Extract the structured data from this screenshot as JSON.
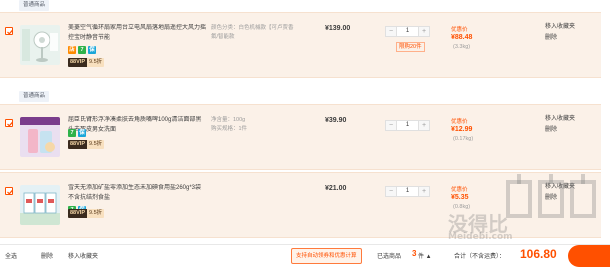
{
  "groups": [
    {
      "label": "普通商品"
    },
    {
      "label": "普通商品"
    }
  ],
  "items": [
    {
      "title": "美菱空气循环扇家用台立电风扇落地扇遥控大风力摇控宝时静音节能",
      "badges": [
        "店",
        "7",
        "保"
      ],
      "vip_left": "88VIP",
      "vip_right": "9.5折",
      "sku_line1": "颜色分类：白色机械款【可卢贾香",
      "sku_line2": "氟/智能款",
      "price": "¥139.00",
      "qty": "1",
      "qty_minus": "−",
      "qty_plus": "+",
      "limit": "限购20件",
      "sub_label": "优惠价",
      "sub_total": "¥88.48",
      "weight": "(3.3kg)",
      "op1": "移入收藏夹",
      "op2": "删除"
    },
    {
      "title": "屈臣氏臂形浮净凑柔肤去角质嘴啤100g清洁面部黑头去死皮男女洗面",
      "badges": [
        "7",
        "保"
      ],
      "vip_left": "88VIP",
      "vip_right": "9.5折",
      "sku_line1": "净含量：100g",
      "sku_line2": "购买规格：1件",
      "price": "¥39.90",
      "qty": "1",
      "qty_minus": "−",
      "qty_plus": "+",
      "limit": "",
      "sub_label": "优惠价",
      "sub_total": "¥12.99",
      "weight": "(0.17kg)",
      "op1": "移入收藏夹",
      "op2": "删除"
    },
    {
      "title": "雪天无添加矿盐零添加生态未加碘食用盐260g*3袋不含抗结剂食盐",
      "badges": [
        "7",
        "保"
      ],
      "vip_left": "88VIP",
      "vip_right": "9.5折",
      "sku_line1": "",
      "sku_line2": "",
      "price": "¥21.00",
      "qty": "1",
      "qty_minus": "−",
      "qty_plus": "+",
      "limit": "",
      "sub_label": "优惠价",
      "sub_total": "¥5.35",
      "weight": "(0.8kg)",
      "op1": "移入收藏夹",
      "op2": "删除"
    }
  ],
  "footer": {
    "select_all": "全选",
    "delete": "删除",
    "move_fav": "移入收藏夹",
    "promo": "支持自动领券和优惠计算",
    "selected_label": "已选商品",
    "selected_count": "3",
    "selected_unit": "件 ▲",
    "total_label": "合计（不含运费）：",
    "total_value": "106.80"
  },
  "watermark": {
    "cn": "没得比",
    "en": "Meidebi.com"
  },
  "colors": {
    "accent": "#ff5000",
    "row_bg": "#fbf1e8"
  }
}
